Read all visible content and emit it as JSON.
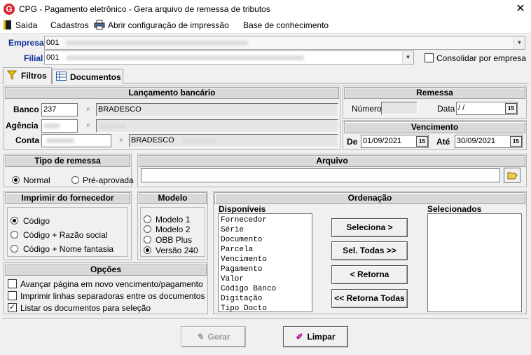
{
  "window": {
    "icon_letter": "G",
    "title": "CPG -  Pagamento eletrônico - Gera arquivo de remessa de tributos",
    "close_glyph": "✕"
  },
  "menu": {
    "saida": "Saída",
    "cadastros": "Cadastros",
    "abrir_config": "Abrir configuração de impressão",
    "base": "Base de conhecimento"
  },
  "header": {
    "empresa_label": "Empresa",
    "empresa_value": "001",
    "filial_label": "Filial",
    "filial_value": "001",
    "consolidar_label": "Consolidar por empresa",
    "consolidar_checked": false
  },
  "tabs": {
    "filtros": "Filtros",
    "documentos": "Documentos"
  },
  "lancamento": {
    "title": "Lançamento bancário",
    "banco_label": "Banco",
    "banco_code": "237",
    "banco_name": "BRADESCO",
    "agencia_label": "Agência",
    "conta_label": "Conta",
    "conta_bank": "BRADESCO"
  },
  "remessa": {
    "title": "Remessa",
    "numero_label": "Número",
    "data_label": "Data",
    "data_value": " /  /",
    "cal_glyph": "15"
  },
  "vencimento": {
    "title": "Vencimento",
    "de_label": "De",
    "de_value": "01/09/2021",
    "ate_label": "Até",
    "ate_value": "30/09/2021"
  },
  "tipo_remessa": {
    "title": "Tipo de remessa",
    "options": [
      "Normal",
      "Pré-aprovada"
    ],
    "selected": "Normal"
  },
  "arquivo": {
    "title": "Arquivo",
    "value": ""
  },
  "imprimir": {
    "title": "Imprimir do fornecedor",
    "options": [
      "Código",
      "Código + Razão social",
      "Código + Nome fantasia"
    ],
    "selected": "Código"
  },
  "modelo": {
    "title": "Modelo",
    "options": [
      "Modelo 1",
      "Modelo 2",
      "OBB Plus",
      "Versão 240"
    ],
    "selected": "Versão 240"
  },
  "opcoes": {
    "title": "Opções",
    "items": [
      {
        "label": "Avançar página em novo vencimento/pagamento",
        "checked": false
      },
      {
        "label": "Imprimir linhas separadoras entre os documentos",
        "checked": false
      },
      {
        "label": "Listar os documentos para seleção",
        "checked": true
      }
    ]
  },
  "ordenacao": {
    "title": "Ordenação",
    "disponiveis_label": "Disponíveis",
    "selecionados_label": "Selecionados",
    "disponiveis": [
      "Fornecedor",
      "Série",
      "Documento",
      "Parcela",
      "Vencimento",
      "Pagamento",
      "Valor",
      "Código Banco",
      "Digitação",
      "Tipo Docto"
    ],
    "selecionados": [],
    "btn_seleciona": "Seleciona >",
    "btn_sel_todas": "Sel. Todas >>",
    "btn_retorna": "< Retorna",
    "btn_retorna_todas": "<< Retorna Todas"
  },
  "footer": {
    "gerar": "Gerar",
    "limpar": "Limpar"
  }
}
